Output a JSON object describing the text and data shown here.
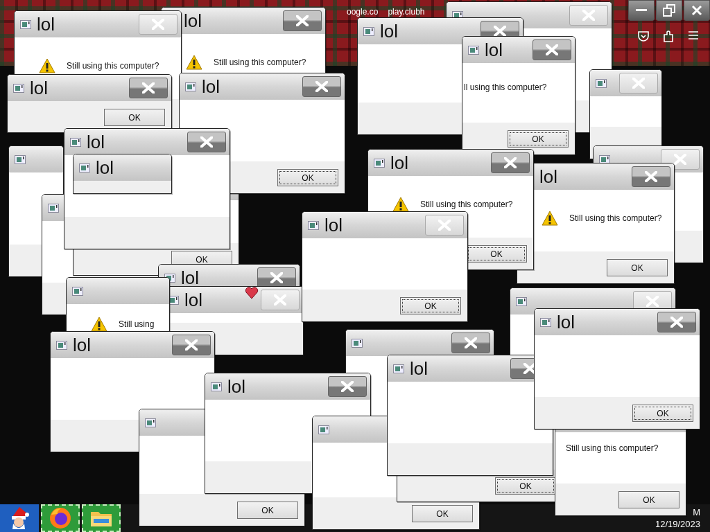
{
  "browser": {
    "tabs": [
      {
        "title": "oogle.co"
      },
      {
        "title": "play.clubh"
      }
    ]
  },
  "dialogs": [
    {
      "close": true,
      "close_dark": false
    },
    {
      "title": "lol",
      "close": true,
      "close_dark": false,
      "warning": true,
      "message": "Still using this computer?"
    },
    {
      "title": "lol",
      "close": true,
      "close_dark": true,
      "warning": true,
      "message": "Still using this computer?"
    },
    {
      "title": "lol",
      "close": true,
      "close_dark": true
    },
    {
      "title": "lol",
      "close": true,
      "close_dark": true,
      "warning": false,
      "message": "ll using this computer?",
      "ok": "OK",
      "ok_focused": true
    },
    {
      "close": true,
      "close_dark": false
    },
    {
      "title": "lol",
      "close": true,
      "close_dark": true,
      "ok": "OK",
      "ok_focused": false
    },
    {
      "title": "lol",
      "close": true,
      "close_dark": true,
      "ok": "OK",
      "ok_focused": true
    },
    {
      "title": "lol",
      "close": true,
      "close_dark": true
    },
    {
      "close": false
    },
    {
      "close": true,
      "close_dark": false
    },
    {
      "title": "lol",
      "close": true,
      "close_dark": true,
      "warning": true,
      "message": "Still using this computer?",
      "ok": "OK",
      "ok_focused": true
    },
    {
      "title": "lol",
      "close": false
    },
    {
      "title": "lol",
      "close": true,
      "close_dark": true,
      "warning": true,
      "message": "Still using this computer?",
      "ok": "OK",
      "ok_focused": false
    },
    {
      "close": false,
      "ok": "OK",
      "ok_focused": false
    },
    {
      "close": false
    },
    {
      "title": "lol",
      "close": true,
      "close_dark": false,
      "ok": "OK",
      "ok_focused": true
    },
    {
      "title": "lol",
      "close": true,
      "close_dark": true
    },
    {
      "close": false,
      "warning": true,
      "message": "Still using"
    },
    {
      "title": "lol",
      "close": true,
      "close_dark": false
    },
    {
      "close": true,
      "close_dark": false
    },
    {
      "title": "lol",
      "close": true,
      "close_dark": true,
      "ok": "OK",
      "ok_focused": true
    },
    {
      "close": true,
      "close_dark": true
    },
    {
      "title": "lol",
      "close": true,
      "close_dark": true
    },
    {
      "title": "lol",
      "close": true,
      "close_dark": true
    },
    {
      "title": "lol",
      "close": true,
      "close_dark": true
    },
    {
      "close": false,
      "ok": "OK",
      "ok_focused": true
    },
    {
      "close": false,
      "warning": false,
      "message": "Still using this computer?",
      "ok": "OK",
      "ok_focused": false
    },
    {
      "close": false,
      "ok": "OK",
      "ok_focused": false
    },
    {
      "close": false,
      "ok": "OK",
      "ok_focused": false
    }
  ],
  "taskbar": {
    "apps": [
      {
        "kind": "start"
      },
      {
        "kind": "firefox"
      },
      {
        "kind": "explorer"
      }
    ],
    "clock": {
      "time": "M",
      "date": "12/19/2023"
    }
  }
}
